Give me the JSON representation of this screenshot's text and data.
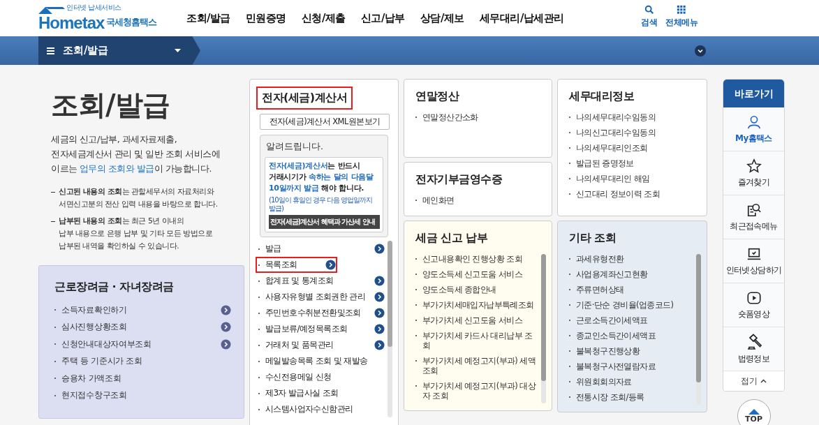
{
  "header": {
    "logo": {
      "tagline": "인터넷 납세서비스",
      "brand": "Hometax",
      "org": "국세청홈택스"
    },
    "nav": [
      "조회/발급",
      "민원증명",
      "신청/제출",
      "신고/납부",
      "상담/제보",
      "세무대리/납세관리"
    ],
    "tools": [
      {
        "kind": "search",
        "label": "검색"
      },
      {
        "kind": "menu",
        "label": "전체메뉴"
      }
    ]
  },
  "menu_bar": {
    "label": "조회/발급"
  },
  "intro": {
    "title": "조회/발급",
    "description": "세금의 신고/납부, 과세자료제출,\n전자세금계산서 관리 및 일반 조회 서비스에\n이르는 **업무의 조회와 발급**이 가능합니다.",
    "notes": [
      "**신고된 내용의 조회**는 관할세무서의 자료처리와\n서면신고분의 전산 입력 내용을 바탕으로 합니다.",
      "**납부된 내용의 조회**는 최근 5년 이내의\n납부 내용으로 은행 납부 및 기타 모든 방법으로\n납부된 내역을 확인하실 수 있습니다."
    ],
    "card": {
      "title": "근로장려금 · 자녀장려금",
      "items": [
        {
          "label": "소득자료확인하기",
          "arrow": true
        },
        {
          "label": "심사진행상황조회",
          "arrow": true
        },
        {
          "label": "신청안내대상자여부조회",
          "arrow": true
        },
        {
          "label": "주택 등 기준시가 조회",
          "arrow": false
        },
        {
          "label": "승용차 가액조회",
          "arrow": false
        },
        {
          "label": "현지접수창구조회",
          "arrow": false
        }
      ]
    }
  },
  "invoice": {
    "title": "전자(세금)계산서",
    "highlighted": true,
    "button": "전자(세금)계산서 XML원본보기",
    "notice": {
      "title": "알려드립니다.",
      "message": "**전자(세금)계산서**는 반드시\n거래시기가 **속하는 달의 다음달\n10일까지 발급** 해야 합니다.",
      "footnote": "(10일이 휴일인 경우 다음 영업일까지 발급)",
      "banner": "전자(세금)계산서 혜택과 가산세 안내"
    },
    "items": [
      {
        "label": "발급",
        "arrow": true,
        "highlighted": false
      },
      {
        "label": "목록조회",
        "arrow": true,
        "highlighted": true
      },
      {
        "label": "합계표 및 통계조회",
        "arrow": true,
        "highlighted": false
      },
      {
        "label": "사용자유형별 조회권한 관리",
        "arrow": true,
        "highlighted": false
      },
      {
        "label": "주민번호수취분전환및조회",
        "arrow": true,
        "highlighted": false
      },
      {
        "label": "발급보류/예정목록조회",
        "arrow": true,
        "highlighted": false
      },
      {
        "label": "거래처 및 품목관리",
        "arrow": true,
        "highlighted": false
      },
      {
        "label": "메일발송목록 조회 및 재발송",
        "arrow": false,
        "highlighted": false
      },
      {
        "label": "수신전용메일 신청",
        "arrow": false,
        "highlighted": false
      },
      {
        "label": "제3자 발급사실 조회",
        "arrow": false,
        "highlighted": false
      },
      {
        "label": "시스템사업자수신함관리",
        "arrow": false,
        "highlighted": false
      }
    ]
  },
  "columns": [
    [
      {
        "title": "연말정산",
        "kind": "plain",
        "scrollable": false,
        "items": [
          "연말정산간소화"
        ]
      },
      {
        "title": "전자기부금영수증",
        "kind": "plain",
        "scrollable": false,
        "items": [
          "메인화면"
        ]
      },
      {
        "title": "세금 신고 납부",
        "kind": "cream",
        "scrollable": true,
        "items": [
          "신고내용확인 진행상황 조회",
          "양도소득세 신고도움 서비스",
          "양도소득세 종합안내",
          "부가가치세매입자납부특례조회",
          "부가가치세 신고도움 서비스",
          "부가가치세 카드사 대리납부 조회",
          "부가가치세 예정고지(부과) 세액조회",
          "부가가치세 예정고지(부과) 대상자 조회"
        ]
      }
    ],
    [
      {
        "title": "세무대리정보",
        "kind": "plain",
        "scrollable": false,
        "items": [
          "나의세무대리수임동의",
          "나의신고대리수임동의",
          "나의세무대리인조회",
          "발급된 증명정보",
          "나의세무대리인 해임",
          "신고대리 정보이력 조회"
        ]
      },
      {
        "title": "기타 조회",
        "kind": "blue",
        "scrollable": true,
        "items": [
          "과세유형전환",
          "사업용계좌신고현황",
          "주류면허상태",
          "기준·단순 경비율(업종코드)",
          "근로소득간이세액표",
          "종교인소득간이세액표",
          "불복청구진행상황",
          "불복청구사전열람자료",
          "위원회회의자료",
          "전통시장 조회/등록"
        ]
      }
    ]
  ],
  "quick_menu": {
    "title": "바로가기",
    "items": [
      {
        "kind": "person",
        "label": "My홈택스",
        "selected": true
      },
      {
        "kind": "star",
        "label": "즐겨찾기",
        "selected": false
      },
      {
        "kind": "recent",
        "label": "최근접속메뉴",
        "selected": false
      },
      {
        "kind": "laptop",
        "label": "인터넷상담하기",
        "selected": false
      },
      {
        "kind": "play",
        "label": "숏폼영상",
        "selected": false
      },
      {
        "kind": "gavel",
        "label": "법령정보",
        "selected": false
      }
    ],
    "collapse": "접기",
    "top": "TOP"
  }
}
